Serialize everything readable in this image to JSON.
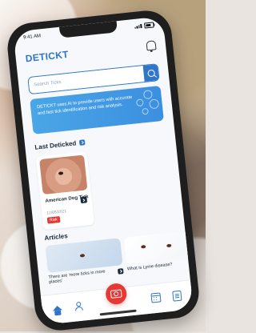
{
  "status_bar": {
    "time": "9:41 AM"
  },
  "app": {
    "name": "DETICKT"
  },
  "search": {
    "placeholder": "Search Ticks"
  },
  "banner": {
    "text": "DETICKT uses AI to provide users with accurate and fast tick identification and risk analysis."
  },
  "sections": {
    "last_deticked": "Last Deticked",
    "articles": "Articles"
  },
  "last_deticked_card": {
    "name": "American Dog Tick",
    "date": "12/05/2021",
    "badge": "Risk"
  },
  "articles": [
    {
      "title": "There are 'more ticks in more places'"
    },
    {
      "title": "What is Lyme disease?"
    }
  ],
  "icons": {
    "notifications": "bell-icon",
    "search": "search-icon",
    "home": "home-icon",
    "profile": "user-icon",
    "scan": "camera-icon",
    "calendar": "calendar-icon",
    "documents": "doc-icon"
  },
  "colors": {
    "primary": "#2f76c9",
    "accent": "#e53935",
    "banner": "#3c8fe0"
  }
}
